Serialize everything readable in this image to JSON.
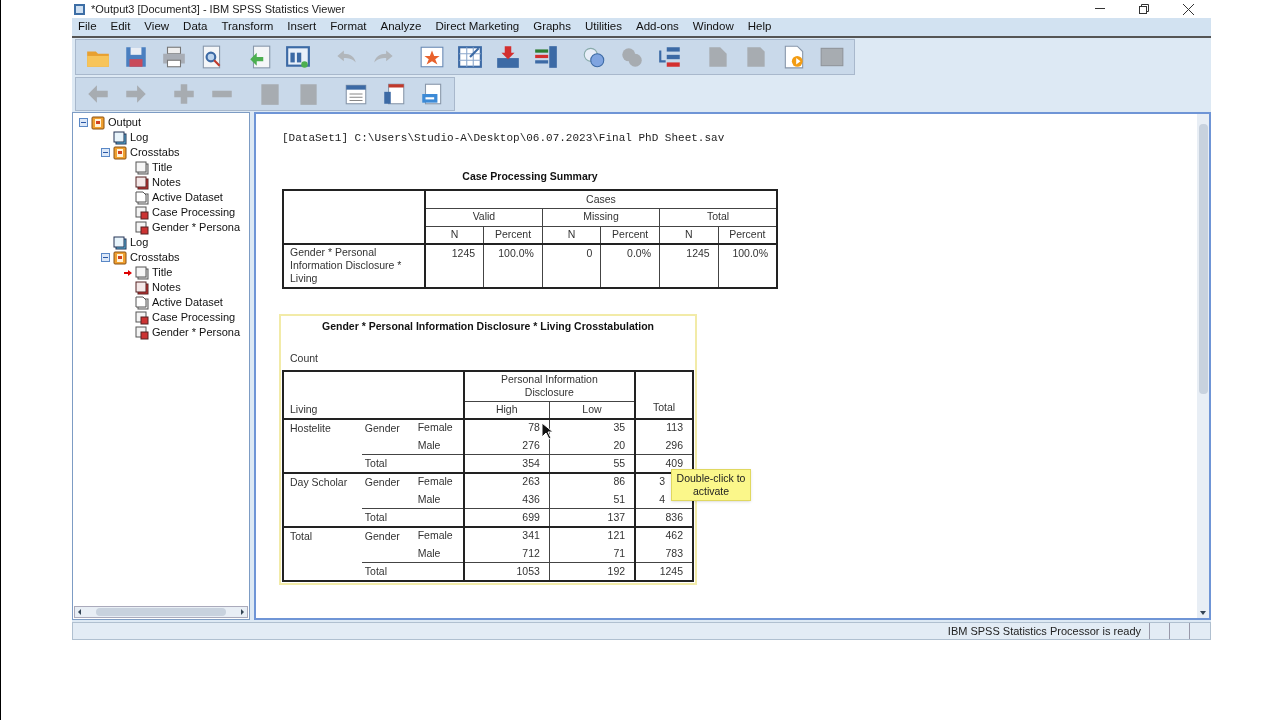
{
  "window": {
    "title": "*Output3 [Document3] - IBM SPSS Statistics Viewer"
  },
  "menu": [
    "File",
    "Edit",
    "View",
    "Data",
    "Transform",
    "Insert",
    "Format",
    "Analyze",
    "Direct Marketing",
    "Graphs",
    "Utilities",
    "Add-ons",
    "Window",
    "Help"
  ],
  "toolbar_1": [
    {
      "disabled": false
    },
    {
      "disabled": false
    },
    {
      "disabled": false
    },
    {
      "disabled": false
    },
    {
      "disabled": false
    },
    {
      "disabled": false
    },
    {
      "disabled": true
    },
    {
      "disabled": true
    },
    {
      "disabled": false
    },
    {
      "disabled": false
    },
    {
      "disabled": false
    },
    {
      "disabled": false
    },
    {
      "disabled": false
    },
    {
      "disabled": true
    },
    {
      "disabled": false
    },
    {
      "disabled": true
    },
    {
      "disabled": true
    },
    {
      "disabled": false
    },
    {
      "disabled": true
    }
  ],
  "toolbar_2": [
    {
      "disabled": true
    },
    {
      "disabled": true
    },
    {
      "disabled": true
    },
    {
      "disabled": true
    },
    {
      "disabled": true
    },
    {
      "disabled": true
    },
    {
      "disabled": false
    },
    {
      "disabled": false
    },
    {
      "disabled": false
    }
  ],
  "outline": [
    {
      "label": "Output",
      "kind": "book",
      "expanded": true,
      "children": [
        {
          "label": "Log",
          "kind": "log",
          "marked": false
        },
        {
          "label": "Crosstabs",
          "kind": "book",
          "expanded": true,
          "children": [
            {
              "label": "Title",
              "kind": "title",
              "marked": false
            },
            {
              "label": "Notes",
              "kind": "notes",
              "marked": false
            },
            {
              "label": "Active Dataset",
              "kind": "page",
              "marked": false
            },
            {
              "label": "Case Processing",
              "kind": "table",
              "marked": false
            },
            {
              "label": "Gender * Persona",
              "kind": "table",
              "marked": false
            }
          ]
        },
        {
          "label": "Log",
          "kind": "log",
          "marked": false
        },
        {
          "label": "Crosstabs",
          "kind": "book",
          "expanded": true,
          "children": [
            {
              "label": "Title",
              "kind": "title",
              "marked": true
            },
            {
              "label": "Notes",
              "kind": "notes",
              "marked": false
            },
            {
              "label": "Active Dataset",
              "kind": "page",
              "marked": false
            },
            {
              "label": "Case Processing",
              "kind": "table",
              "marked": false
            },
            {
              "label": "Gender * Persona",
              "kind": "table",
              "marked": false
            }
          ]
        }
      ]
    }
  ],
  "output": {
    "dataset_line": "[DataSet1] C:\\Users\\Studio-A\\Desktop\\06.07.2023\\Final PhD Sheet.sav",
    "case_summary": {
      "title": "Case Processing Summary",
      "group": "Cases",
      "subgroups": [
        "Valid",
        "Missing",
        "Total"
      ],
      "columns": [
        "N",
        "Percent",
        "N",
        "Percent",
        "N",
        "Percent"
      ],
      "rows": [
        {
          "label": "Gender * Personal Information Disclosure  * Living",
          "values": [
            "1245",
            "100.0%",
            "0",
            "0.0%",
            "1245",
            "100.0%"
          ]
        }
      ]
    },
    "crosstab": {
      "title": "Gender  * Personal Information Disclosure  * Living Crosstabulation",
      "statistic": "Count",
      "row_header": "Living",
      "column_group": "Personal Information Disclosure",
      "columns": [
        "High",
        "Low"
      ],
      "total_column": "Total",
      "groups": [
        {
          "label": "Hostelite",
          "gender_label": "Gender",
          "rows": [
            {
              "label": "Female",
              "values": [
                "78",
                "35",
                "113"
              ],
              "under_tooltip": false
            },
            {
              "label": "Male",
              "values": [
                "276",
                "20",
                "296"
              ],
              "under_tooltip": false
            }
          ],
          "total": {
            "label": "Total",
            "values": [
              "354",
              "55",
              "409"
            ]
          }
        },
        {
          "label": "Day Scholar",
          "gender_label": "Gender",
          "rows": [
            {
              "label": "Female",
              "values": [
                "263",
                "86",
                "3"
              ],
              "under_tooltip": true
            },
            {
              "label": "Male",
              "values": [
                "436",
                "51",
                "4"
              ],
              "under_tooltip": true
            }
          ],
          "total": {
            "label": "Total",
            "values": [
              "699",
              "137",
              "836"
            ]
          }
        },
        {
          "label": "Total",
          "gender_label": "Gender",
          "rows": [
            {
              "label": "Female",
              "values": [
                "341",
                "121",
                "462"
              ],
              "under_tooltip": false
            },
            {
              "label": "Male",
              "values": [
                "712",
                "71",
                "783"
              ],
              "under_tooltip": false
            }
          ],
          "total": {
            "label": "Total",
            "values": [
              "1053",
              "192",
              "1245"
            ]
          }
        }
      ]
    },
    "tooltip": "Double-click to activate"
  },
  "status_bar": {
    "text": "IBM SPSS Statistics Processor is ready"
  }
}
